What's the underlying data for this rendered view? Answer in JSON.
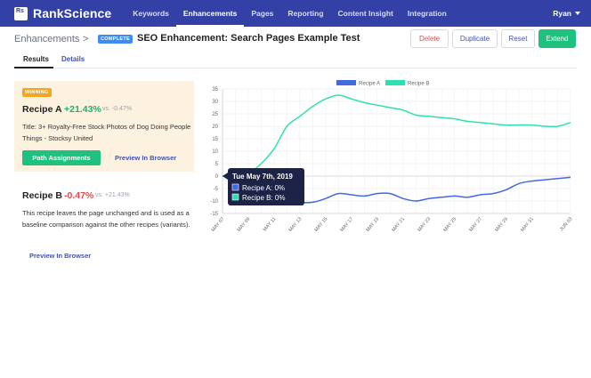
{
  "app": {
    "logo_mark": "Rs",
    "name": "RankScience"
  },
  "nav": {
    "items": [
      {
        "label": "Keywords"
      },
      {
        "label": "Enhancements"
      },
      {
        "label": "Pages"
      },
      {
        "label": "Reporting"
      },
      {
        "label": "Content Insight"
      },
      {
        "label": "Integration"
      }
    ],
    "active_index": 1,
    "user": "Ryan"
  },
  "header": {
    "breadcrumb": "Enhancements",
    "separator": ">",
    "status_badge": "COMPLETE",
    "title": "SEO Enhancement: Search Pages Example Test",
    "buttons": {
      "delete": "Delete",
      "duplicate": "Duplicate",
      "reset": "Reset",
      "extend": "Extend"
    }
  },
  "tabs": {
    "results": "Results",
    "details": "Details",
    "active": "Results"
  },
  "recipe_a": {
    "badge": "WINNING",
    "name": "Recipe A",
    "change": "+21.43%",
    "vs": "vs. -0.47%",
    "description": "Title: 3+ Royalty-Free Stock Photos of Dog Doing People Things - Stocksy United",
    "primary_button": "Path Assignments",
    "preview_link": "Preview In Browser"
  },
  "recipe_b": {
    "name": "Recipe B",
    "change": "-0.47%",
    "vs": "vs. +21.43%",
    "description": "This recipe leaves the page unchanged and is used as a baseline comparison against the other recipes (variants).",
    "preview_link": "Preview In Browser"
  },
  "colors": {
    "nav_bg": "#3341a6",
    "accent_green": "#1fc17f",
    "positive": "#1fae6e",
    "negative": "#e24b4b",
    "link": "#4051b5",
    "winning_bg": "#fdf2e0",
    "winning_badge": "#f4a623",
    "complete_badge": "#3f8cf0"
  },
  "chart_data": {
    "type": "line",
    "x": [
      "MAY 07",
      "MAY 08",
      "MAY 09",
      "MAY 10",
      "MAY 11",
      "MAY 12",
      "MAY 13",
      "MAY 14",
      "MAY 15",
      "MAY 16",
      "MAY 17",
      "MAY 18",
      "MAY 19",
      "MAY 20",
      "MAY 21",
      "MAY 22",
      "MAY 23",
      "MAY 24",
      "MAY 25",
      "MAY 26",
      "MAY 27",
      "MAY 28",
      "MAY 29",
      "MAY 30",
      "MAY 31",
      "JUN 01",
      "JUN 02",
      "JUN 03"
    ],
    "x_tick_labels": [
      "MAY 07",
      "MAY 09",
      "MAY 11",
      "MAY 13",
      "MAY 15",
      "MAY 17",
      "MAY 19",
      "MAY 21",
      "MAY 23",
      "MAY 25",
      "MAY 27",
      "MAY 29",
      "MAY 31",
      "JUN 03"
    ],
    "series": [
      {
        "name": "Recipe A",
        "color": "#4169e1",
        "values": [
          0,
          0,
          -1,
          -4,
          -7,
          -9.5,
          -10.5,
          -10.5,
          -9,
          -7,
          -7.5,
          -8,
          -7,
          -7,
          -9,
          -10,
          -9,
          -8.5,
          -8,
          -8.5,
          -7.5,
          -7,
          -5.5,
          -3,
          -2,
          -1.5,
          -1,
          -0.5
        ]
      },
      {
        "name": "Recipe B",
        "color": "#2ee0b0",
        "values": [
          0,
          0,
          1,
          5,
          11,
          20,
          24,
          28,
          31,
          32.5,
          31,
          29.5,
          28.5,
          27.5,
          26.5,
          24.5,
          24,
          23.5,
          23,
          22,
          21.5,
          21,
          20.5,
          20.5,
          20.5,
          20,
          20,
          21.5
        ]
      }
    ],
    "ylim": [
      -15,
      35
    ],
    "yticks": [
      -15,
      -10,
      -5,
      0,
      5,
      10,
      15,
      20,
      25,
      30,
      35
    ],
    "grid": true,
    "legend": "top-center",
    "tooltip": {
      "title": "Tue May 7th, 2019",
      "lines": [
        "Recipe A: 0%",
        "Recipe B: 0%"
      ]
    }
  }
}
